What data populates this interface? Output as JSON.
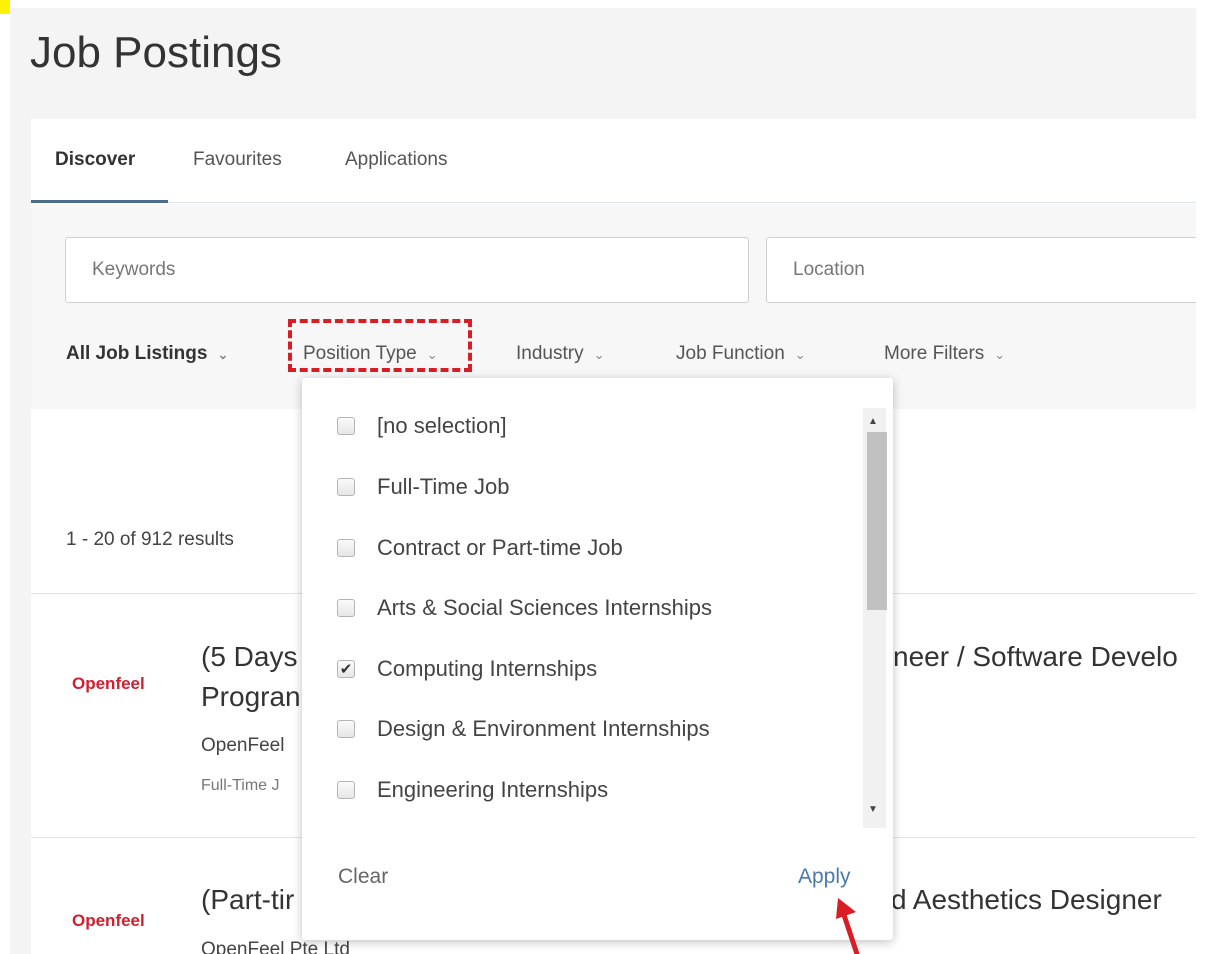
{
  "page": {
    "title": "Job Postings"
  },
  "tabs": [
    {
      "label": "Discover",
      "active": true
    },
    {
      "label": "Favourites",
      "active": false
    },
    {
      "label": "Applications",
      "active": false
    }
  ],
  "search": {
    "keywords_placeholder": "Keywords",
    "location_placeholder": "Location"
  },
  "filters": {
    "all_job_listings": "All Job Listings",
    "position_type": "Position Type",
    "industry": "Industry",
    "job_function": "Job Function",
    "more_filters": "More Filters",
    "chevron": "⌄"
  },
  "results": {
    "count_text": "1 - 20 of 912 results"
  },
  "jobs": [
    {
      "logo_text": "Openfeel",
      "title_left_line1": "(5 Days",
      "title_left_line2": "Progran",
      "title_right": "neer / Software Develo",
      "company": "OpenFeel",
      "meta": "Full-Time J"
    },
    {
      "logo_text": "Openfeel",
      "title_left_line1": "(Part-tir",
      "title_right": "d Aesthetics Designer",
      "company": "OpenFeel Pte Ltd"
    }
  ],
  "dropdown": {
    "options": [
      {
        "label": "[no selection]",
        "checked": false
      },
      {
        "label": "Full-Time Job",
        "checked": false
      },
      {
        "label": "Contract or Part-time Job",
        "checked": false
      },
      {
        "label": "Arts & Social Sciences Internships",
        "checked": false
      },
      {
        "label": "Computing Internships",
        "checked": true
      },
      {
        "label": "Design & Environment Internships",
        "checked": false
      },
      {
        "label": "Engineering Internships",
        "checked": false
      }
    ],
    "clear_label": "Clear",
    "apply_label": "Apply"
  },
  "colors": {
    "annotation_red": "#d81e24",
    "accent_blue": "#4b7aa8",
    "logo_red": "#d0202f"
  },
  "icons": {
    "check": "✔",
    "scroll_up": "▲",
    "scroll_down": "▼"
  }
}
